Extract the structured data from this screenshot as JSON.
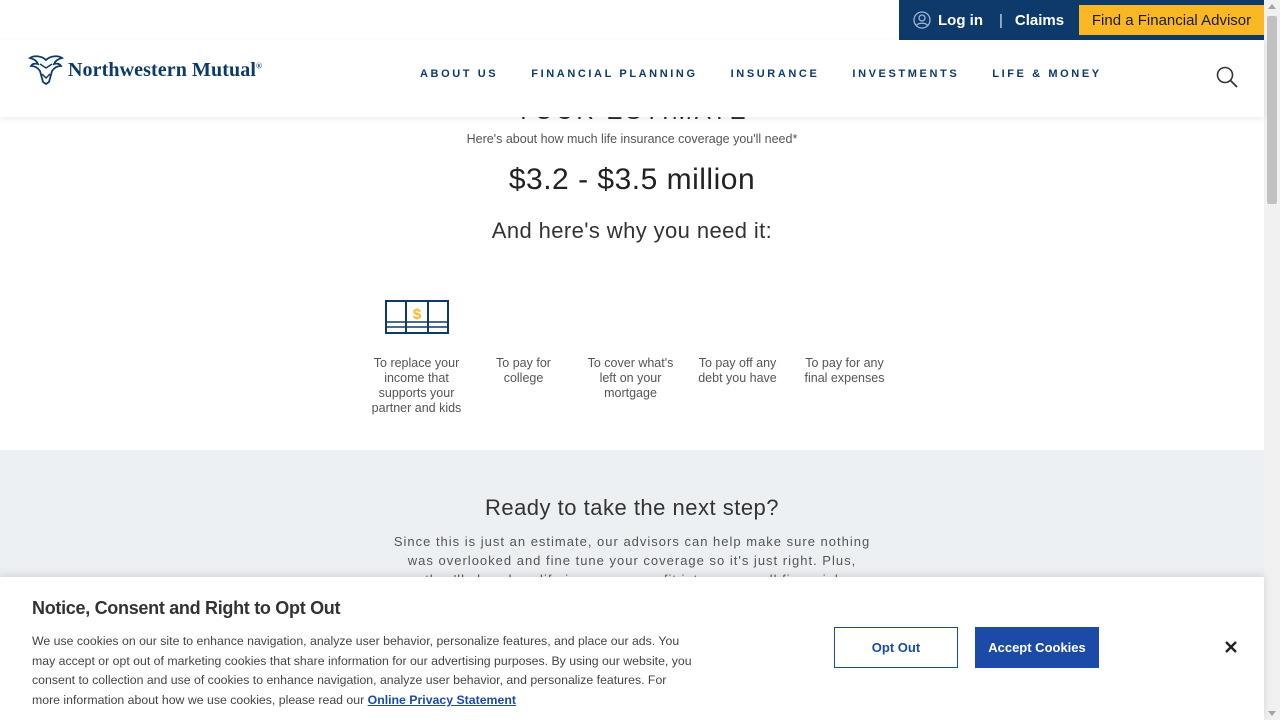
{
  "utility": {
    "login_label": "Log in",
    "separator": "|",
    "claims_label": "Claims",
    "advisor_label": "Find a Financial Advisor"
  },
  "header": {
    "logo_text": "Northwestern Mutual",
    "logo_mark": "®",
    "nav": [
      {
        "label": "ABOUT US"
      },
      {
        "label": "FINANCIAL PLANNING"
      },
      {
        "label": "INSURANCE"
      },
      {
        "label": "INVESTMENTS"
      },
      {
        "label": "LIFE & MONEY"
      }
    ]
  },
  "estimate": {
    "heading_partial": "YOUR ESTIMATE",
    "subtitle": "Here's about how much life insurance coverage you'll need*",
    "amount": "$3.2 - $3.5 million",
    "why": "And here's why you need it:",
    "reasons": [
      {
        "label": "To replace your income that supports your partner and kids",
        "icon": "money-icon"
      },
      {
        "label": "To pay for college",
        "icon": ""
      },
      {
        "label": "To cover what's left on your mortgage",
        "icon": ""
      },
      {
        "label": "To pay off any debt you have",
        "icon": ""
      },
      {
        "label": "To pay for any final expenses",
        "icon": ""
      }
    ]
  },
  "next_step": {
    "title": "Ready to take the next step?",
    "body": "Since this is just an estimate, our advisors can help make sure nothing was overlooked and fine tune your coverage so it's just right. Plus, they'll show how life insurance can fit into an overall financial"
  },
  "cookie": {
    "title": "Notice, Consent and Right to Opt Out",
    "body": "We use cookies on our site to enhance navigation, analyze user behavior, personalize features, and place our ads. You may accept or opt out of marketing cookies that share information for our advertising purposes. By using our website, you consent to collection and use of cookies to enhance navigation, analyze user behavior, and personalize features. For more information about how we use cookies, please read our ",
    "link_label": "Online Privacy Statement",
    "opt_out_label": "Opt Out",
    "accept_label": "Accept Cookies",
    "close_icon": "close-icon"
  },
  "colors": {
    "navy": "#0d3a6b",
    "gold": "#f9b823",
    "blue_button": "#1c4aa7",
    "section_gray": "#edf0f2"
  }
}
